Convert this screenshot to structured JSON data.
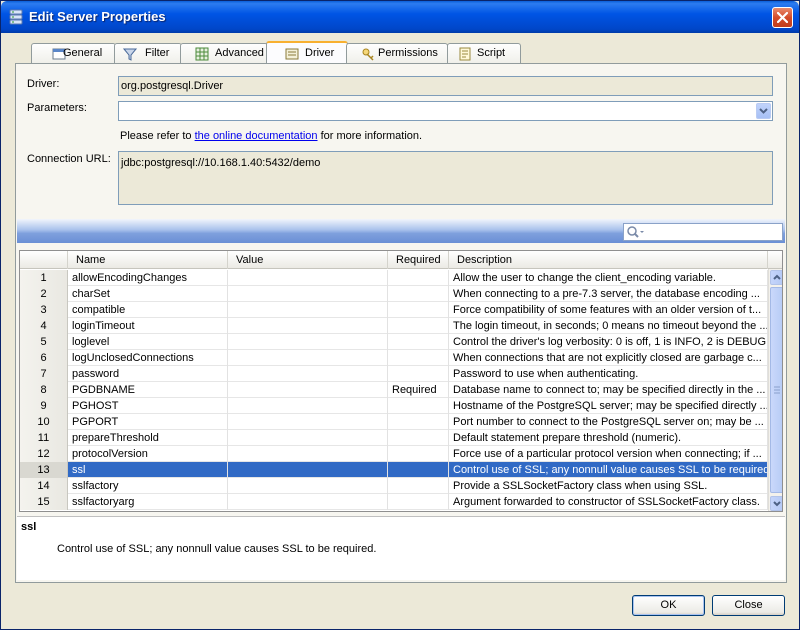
{
  "window": {
    "title": "Edit Server Properties"
  },
  "tabs": [
    {
      "label": "General",
      "icon": "general-icon",
      "active": false
    },
    {
      "label": "Filter",
      "icon": "filter-icon",
      "active": false
    },
    {
      "label": "Advanced",
      "icon": "advanced-icon",
      "active": false
    },
    {
      "label": "Driver",
      "icon": "driver-icon",
      "active": true
    },
    {
      "label": "Permissions",
      "icon": "permissions-icon",
      "active": false
    },
    {
      "label": "Script",
      "icon": "script-icon",
      "active": false
    }
  ],
  "form": {
    "driver_label": "Driver:",
    "driver_value": "org.postgresql.Driver",
    "parameters_label": "Parameters:",
    "parameters_value": "",
    "help_prefix": "Please refer to ",
    "help_link": "the online documentation",
    "help_suffix": " for more information.",
    "url_label": "Connection URL:",
    "url_value": "jdbc:postgresql://10.168.1.40:5432/demo"
  },
  "table": {
    "columns": [
      "Name",
      "Value",
      "Required",
      "Description"
    ],
    "rows": [
      {
        "num": "1",
        "name": "allowEncodingChanges",
        "value": "",
        "required": "",
        "description": "Allow the user to change the client_encoding variable."
      },
      {
        "num": "2",
        "name": "charSet",
        "value": "",
        "required": "",
        "description": "When connecting to a pre-7.3 server, the database encoding ..."
      },
      {
        "num": "3",
        "name": "compatible",
        "value": "",
        "required": "",
        "description": "Force compatibility of some features with an older version of t..."
      },
      {
        "num": "4",
        "name": "loginTimeout",
        "value": "",
        "required": "",
        "description": "The login timeout, in seconds; 0 means no timeout beyond the ..."
      },
      {
        "num": "5",
        "name": "loglevel",
        "value": "",
        "required": "",
        "description": "Control the driver's log verbosity: 0 is off, 1 is INFO, 2 is DEBUG."
      },
      {
        "num": "6",
        "name": "logUnclosedConnections",
        "value": "",
        "required": "",
        "description": "When connections that are not explicitly closed are garbage c..."
      },
      {
        "num": "7",
        "name": "password",
        "value": "",
        "required": "",
        "description": "Password to use when authenticating."
      },
      {
        "num": "8",
        "name": "PGDBNAME",
        "value": "",
        "required": "Required",
        "description": "Database name to connect to; may be specified directly in the ..."
      },
      {
        "num": "9",
        "name": "PGHOST",
        "value": "",
        "required": "",
        "description": "Hostname of the PostgreSQL server; may be specified directly ..."
      },
      {
        "num": "10",
        "name": "PGPORT",
        "value": "",
        "required": "",
        "description": "Port number to connect to the PostgreSQL server on; may be ..."
      },
      {
        "num": "11",
        "name": "prepareThreshold",
        "value": "",
        "required": "",
        "description": "Default statement prepare threshold (numeric)."
      },
      {
        "num": "12",
        "name": "protocolVersion",
        "value": "",
        "required": "",
        "description": "Force use of a particular protocol version when connecting; if ..."
      },
      {
        "num": "13",
        "name": "ssl",
        "value": "",
        "required": "",
        "description": "Control use of SSL; any nonnull value causes SSL to be required.",
        "selected": true
      },
      {
        "num": "14",
        "name": "sslfactory",
        "value": "",
        "required": "",
        "description": "Provide a SSLSocketFactory class when using SSL."
      },
      {
        "num": "15",
        "name": "sslfactoryarg",
        "value": "",
        "required": "",
        "description": "Argument forwarded to constructor of SSLSocketFactory class."
      }
    ]
  },
  "details": {
    "title": "ssl",
    "text": "Control use of SSL; any nonnull value causes SSL to be required."
  },
  "buttons": {
    "ok": "OK",
    "close": "Close"
  },
  "colors": {
    "titlebar": "#0055e5",
    "selection": "#316ac5",
    "active_tab_accent": "#f8b030"
  }
}
